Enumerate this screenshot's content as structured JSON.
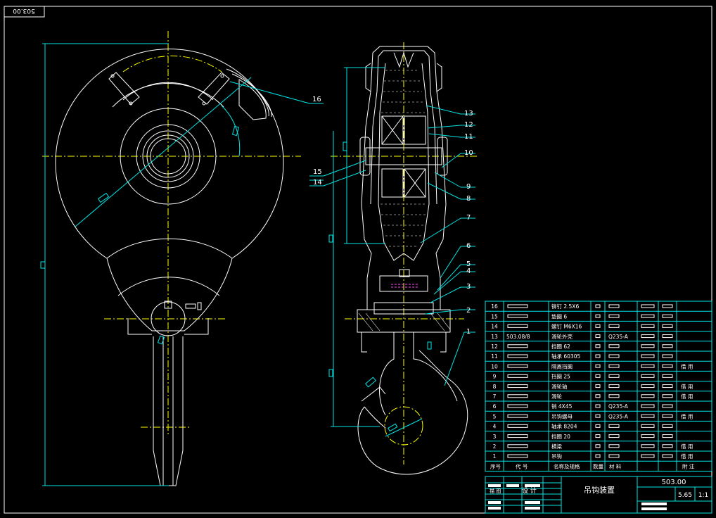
{
  "drawing": {
    "corner_tag": "503.00",
    "drawing_no": "503.00",
    "title": "吊钩装置",
    "weight": "5.65",
    "scale": "1:1",
    "colors": {
      "background": "#000000",
      "outline": "#ffffff",
      "frame": "#00e5e5",
      "centerline": "#ffff00",
      "hatch": "#ff40ff",
      "table": "#00e5e5"
    }
  },
  "callouts": [
    "16",
    "13",
    "12",
    "11",
    "10",
    "15",
    "14",
    "9",
    "8",
    "7",
    "6",
    "5",
    "4",
    "3",
    "2",
    "1"
  ],
  "bom": {
    "headers": [
      "序号",
      "代 号",
      "名称及规格",
      "数量",
      "材 料",
      "",
      "",
      "附 注"
    ],
    "rows": [
      {
        "no": "16",
        "code": "",
        "name": "铆钉 2.5X6",
        "material": "",
        "note": ""
      },
      {
        "no": "15",
        "code": "",
        "name": "垫圈 6",
        "material": "",
        "note": ""
      },
      {
        "no": "14",
        "code": "",
        "name": "螺钉 M6X16",
        "material": "",
        "note": ""
      },
      {
        "no": "13",
        "code": "503.08/8",
        "name": "滑轮外壳",
        "material": "Q235-A",
        "note": ""
      },
      {
        "no": "12",
        "code": "",
        "name": "挡圈 62",
        "material": "",
        "note": ""
      },
      {
        "no": "11",
        "code": "",
        "name": "轴承 60305",
        "material": "",
        "note": ""
      },
      {
        "no": "10",
        "code": "",
        "name": "隔离挡圈",
        "material": "",
        "note": "借 用"
      },
      {
        "no": "9",
        "code": "",
        "name": "挡圈 25",
        "material": "",
        "note": ""
      },
      {
        "no": "8",
        "code": "",
        "name": "滑轮轴",
        "material": "",
        "note": "借 用"
      },
      {
        "no": "7",
        "code": "",
        "name": "滑轮",
        "material": "",
        "note": "借 用"
      },
      {
        "no": "6",
        "code": "",
        "name": "销 4X45",
        "material": "Q235-A",
        "note": ""
      },
      {
        "no": "5",
        "code": "",
        "name": "吊钩螺母",
        "material": "Q235-A",
        "note": "借 用"
      },
      {
        "no": "4",
        "code": "",
        "name": "轴承 8204",
        "material": "",
        "note": ""
      },
      {
        "no": "3",
        "code": "",
        "name": "挡圈 20",
        "material": "",
        "note": ""
      },
      {
        "no": "2",
        "code": "",
        "name": "横梁",
        "material": "",
        "note": "借 用"
      },
      {
        "no": "1",
        "code": "",
        "name": "吊钩",
        "material": "",
        "note": "借 用"
      }
    ]
  },
  "title_block": {
    "mini_labels": [
      "设 计",
      "描 图"
    ]
  }
}
